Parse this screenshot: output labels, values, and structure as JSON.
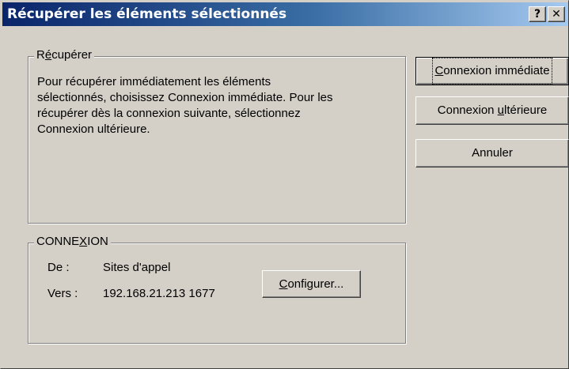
{
  "window": {
    "title": "Récupérer les éléments sélectionnés",
    "help_button": "?",
    "close_button": "✕"
  },
  "recuperer_group": {
    "legend_pre": "R",
    "legend_accel": "é",
    "legend_post": "cupérer",
    "description_lines": [
      "Pour récupérer immédiatement les éléments",
      "sélectionnés, choisissez Connexion immédiate. Pour les",
      "récupérer dès la connexion suivante, sélectionnez",
      "Connexion ultérieure."
    ]
  },
  "connexion_group": {
    "legend_pre": "CONNE",
    "legend_accel": "X",
    "legend_post": "ION",
    "from_label": "De :",
    "from_value": "Sites d'appel",
    "to_label": "Vers :",
    "to_value": "192.168.21.213 1677",
    "configure_button": {
      "pre": "",
      "accel": "C",
      "post": "onfigurer..."
    }
  },
  "actions": {
    "connect_now": {
      "pre": "",
      "accel": "C",
      "post": "onnexion immédiate"
    },
    "connect_later": {
      "pre": "Connexion ",
      "accel": "u",
      "post": "ltérieure"
    },
    "cancel": {
      "label": "Annuler"
    }
  },
  "icons": {
    "help": "help-icon",
    "close": "close-icon"
  }
}
